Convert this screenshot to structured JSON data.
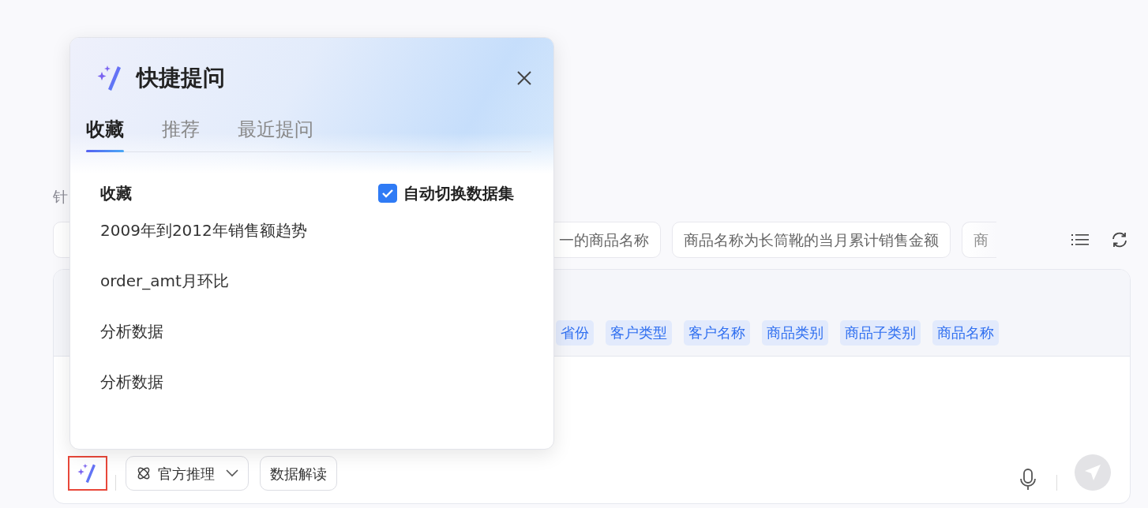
{
  "prompt_label": "针",
  "suggestions": [
    {
      "text": "一的商品名称",
      "faded": false
    },
    {
      "text": "商品名称为长筒靴的当月累计销售金额",
      "faded": false
    },
    {
      "text": "商",
      "faded": true
    }
  ],
  "field_tags": [
    "省份",
    "客户类型",
    "客户名称",
    "商品类别",
    "商品子类别",
    "商品名称"
  ],
  "toolbar": {
    "quick_ask_active": true,
    "model_dropdown": "官方推理",
    "interpret_button": "数据解读",
    "send_disabled": true
  },
  "popup": {
    "title": "快捷提问",
    "tabs": [
      {
        "label": "收藏",
        "selected": true
      },
      {
        "label": "推荐",
        "selected": false
      },
      {
        "label": "最近提问",
        "selected": false
      }
    ],
    "section_title": "收藏",
    "auto_switch": {
      "label": "自动切换数据集",
      "checked": true
    },
    "items": [
      "2009年到2012年销售额趋势",
      "order_amt月环比",
      "分析数据",
      "分析数据"
    ]
  }
}
